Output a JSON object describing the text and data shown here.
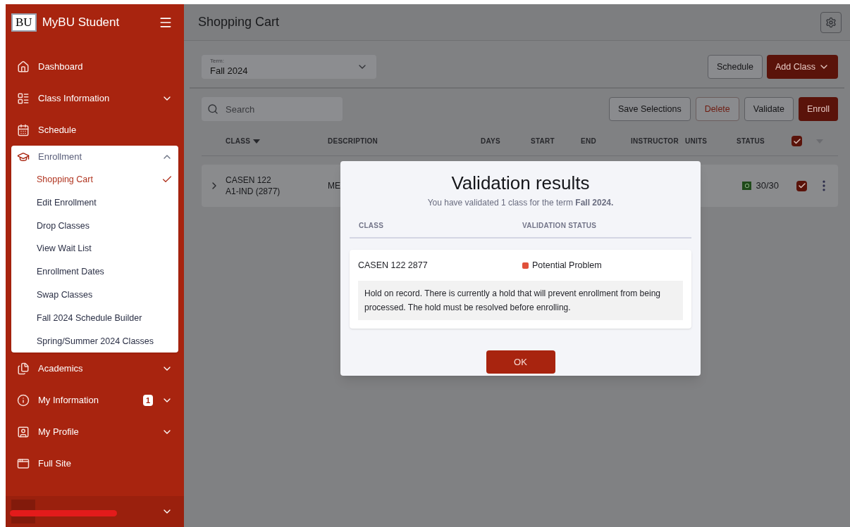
{
  "sidebar": {
    "app_title": "MyBU Student",
    "logo": "BU",
    "items": [
      {
        "label": "Dashboard",
        "kind": "link"
      },
      {
        "label": "Class Information",
        "kind": "group",
        "expanded": false
      },
      {
        "label": "Schedule",
        "kind": "link"
      },
      {
        "label": "Enrollment",
        "kind": "group",
        "expanded": true,
        "children": [
          {
            "label": "Shopping Cart",
            "selected": true
          },
          {
            "label": "Edit Enrollment",
            "selected": false
          },
          {
            "label": "Drop Classes",
            "selected": false
          },
          {
            "label": "View Wait List",
            "selected": false
          },
          {
            "label": "Enrollment Dates",
            "selected": false
          },
          {
            "label": "Swap Classes",
            "selected": false
          },
          {
            "label": "Fall 2024 Schedule Builder",
            "selected": false
          },
          {
            "label": "Spring/Summer 2024 Classes",
            "selected": false
          }
        ]
      },
      {
        "label": "Academics",
        "kind": "group",
        "expanded": false
      },
      {
        "label": "My Information",
        "kind": "group",
        "expanded": false,
        "badge": "1"
      },
      {
        "label": "My Profile",
        "kind": "group",
        "expanded": false
      },
      {
        "label": "Full Site",
        "kind": "link"
      }
    ]
  },
  "page_title": "Shopping Cart",
  "term": {
    "label": "Term:",
    "value": "Fall 2024"
  },
  "top_buttons": [
    {
      "label": "Schedule",
      "kind": "outline"
    },
    {
      "label": "Add Class",
      "kind": "primary-dropdown"
    }
  ],
  "search": {
    "placeholder": "Search"
  },
  "action_buttons": [
    {
      "label": "Save Selections",
      "kind": "outline"
    },
    {
      "label": "Delete",
      "kind": "danger"
    },
    {
      "label": "Validate",
      "kind": "outline"
    },
    {
      "label": "Enroll",
      "kind": "primary"
    }
  ],
  "table": {
    "columns": [
      "CLASS",
      "DESCRIPTION",
      "DAYS",
      "START",
      "END",
      "INSTRUCTOR",
      "UNITS",
      "STATUS"
    ],
    "all_checked": true,
    "rows": [
      {
        "class_line1": "CASEN 122",
        "class_line2": "A1-IND (2877)",
        "description": "ME",
        "status_badge": "O",
        "seats": "30/30",
        "checked": true
      }
    ]
  },
  "dialog": {
    "title": "Validation results",
    "summary": "You have validated 1 class for the term **Fall 2024.**",
    "columns": [
      "CLASS",
      "VALIDATION STATUS"
    ],
    "results": [
      {
        "class": "CASEN 122 2877",
        "status": "Potential Problem",
        "color": "#e0503a",
        "message": "Hold on record. There is currently a hold that will prevent enrollment from being processed. The hold must be resolved before enrolling."
      }
    ],
    "ok": "OK"
  }
}
